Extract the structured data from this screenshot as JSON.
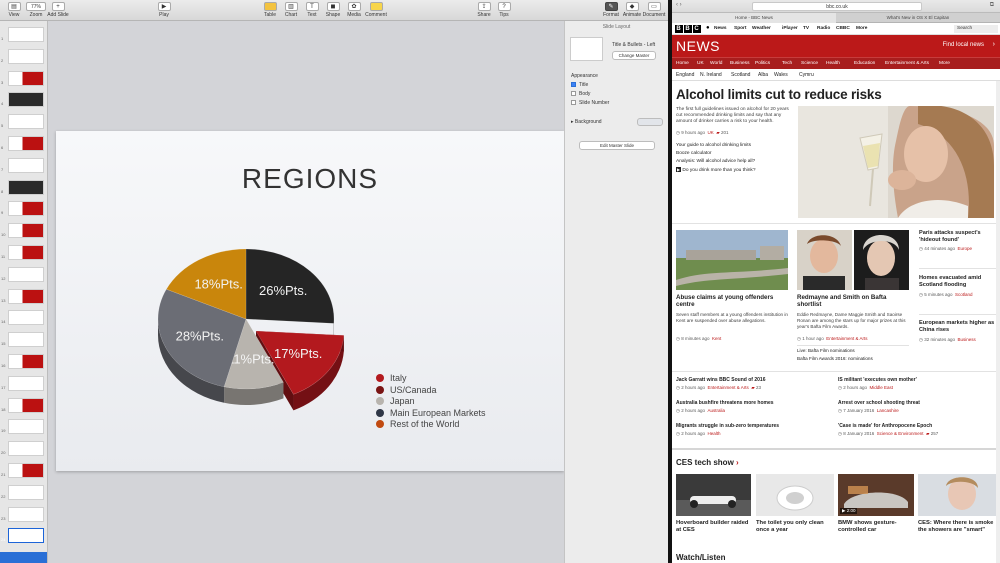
{
  "keynote": {
    "toolbar": {
      "view": "View",
      "zoom_value": "77%",
      "zoom": "Zoom",
      "add_slide": "Add Slide",
      "play": "Play",
      "table": "Table",
      "chart": "Chart",
      "text": "Text",
      "shape": "Shape",
      "media": "Media",
      "comment": "Comment",
      "share": "Share",
      "tips": "Tips",
      "format": "Format",
      "animate": "Animate",
      "document": "Document"
    },
    "slide_numbers": [
      "1",
      "2",
      "3",
      "4",
      "5",
      "6",
      "7",
      "8",
      "9",
      "10",
      "11",
      "12",
      "13",
      "14",
      "15",
      "16",
      "17",
      "18",
      "19",
      "20",
      "21",
      "22",
      "23",
      "24"
    ],
    "slide": {
      "title": "REGIONS"
    },
    "inspector": {
      "header": "Slide Layout",
      "layout_name": "Title & Bullets - Left",
      "change_master": "Change Master",
      "appearance": "Appearance",
      "title_opt": "Title",
      "body_opt": "Body",
      "slide_number_opt": "Slide Number",
      "background": "Background",
      "edit_master": "Edit Master Slide"
    }
  },
  "chart_data": {
    "type": "pie",
    "title": "",
    "slices": [
      {
        "name": "Italy",
        "label": "17%Pts.",
        "value": 17,
        "color": "#b3191e"
      },
      {
        "name": "US/Canada",
        "label": "26%Pts.",
        "value": 26,
        "color": "#252525"
      },
      {
        "name": "Japan",
        "label": "11%Pts.",
        "value": 11,
        "color": "#b8b4ae"
      },
      {
        "name": "Main European Markets",
        "label": "28%Pts.",
        "value": 28,
        "color": "#6b6d75"
      },
      {
        "name": "Rest of the World",
        "label": "18%Pts.",
        "value": 18,
        "color": "#c9860c"
      }
    ],
    "legend": [
      "Italy",
      "US/Canada",
      "Japan",
      "Main European Markets",
      "Rest of the World"
    ],
    "legend_colors": [
      "#b3191e",
      "#7a1414",
      "#b8b4ae",
      "#2e3646",
      "#c14a10"
    ],
    "legend_position": "right"
  },
  "safari": {
    "url": "bbc.co.uk",
    "tabs": [
      "Home - BBC News",
      "What's New in OS X El Capitan"
    ],
    "search": "Search",
    "more": "More"
  },
  "bbc": {
    "top_nav": [
      "News",
      "Sport",
      "Weather",
      "iPlayer",
      "TV",
      "Radio",
      "CBBC",
      "More"
    ],
    "section": "NEWS",
    "find_local": "Find local news",
    "sub_nav": [
      "Home",
      "UK",
      "World",
      "Business",
      "Politics",
      "Tech",
      "Science",
      "Health",
      "Education",
      "Entertainment & Arts",
      "More"
    ],
    "regions": [
      "England",
      "N. Ireland",
      "Scotland",
      "Alba",
      "Wales",
      "Cymru"
    ],
    "lead": {
      "headline": "Alcohol limits cut to reduce risks",
      "summary": "The first full guidelines issued on alcohol for 20 years cut recommended drinking limits and say that any amount of drinker carries a risk to your health.",
      "time": "9 hours ago",
      "section": "UK",
      "comments": "201",
      "links": [
        "Your guide to alcohol drinking limits",
        "Booze calculator",
        "Analysis: Will alcohol advice help all?",
        "Do you drink more than you think?"
      ]
    },
    "stories": [
      {
        "headline": "Abuse claims at young offenders centre",
        "summary": "Seven staff members at a young offenders institution in Kent are suspended over abuse allegations.",
        "time": "8 minutes ago",
        "section": "Kent"
      },
      {
        "headline": "Redmayne and Smith on Bafta shortlist",
        "summary": "Eddie Redmayne, Dame Maggie Smith and Saoirse Ronan are among the stars up for major prizes at this year's Bafta Film Awards.",
        "time": "1 hour ago",
        "section": "Entertainment & Arts",
        "live": "Live: Bafta Film nominations",
        "extra": "Bafta Film Awards 2016: nominations"
      }
    ],
    "side_stories": [
      {
        "headline": "Paris attacks suspect's 'hideout found'",
        "time": "44 minutes ago",
        "section": "Europe"
      },
      {
        "headline": "Homes evacuated amid Scotland flooding",
        "time": "5 minutes ago",
        "section": "Scotland"
      },
      {
        "headline": "European markets higher as China rises",
        "time": "32 minutes ago",
        "section": "Business"
      }
    ],
    "list": [
      {
        "headline": "Jack Garratt wins BBC Sound of 2016",
        "time": "2 hours ago",
        "section": "Entertainment & Arts",
        "comments": "23"
      },
      {
        "headline": "IS militant 'executes own mother'",
        "time": "2 hours ago",
        "section": "Middle East"
      },
      {
        "headline": "Australia bushfire threatens more homes",
        "time": "2 hours ago",
        "section": "Australia"
      },
      {
        "headline": "Arrest over school shooting threat",
        "time": "7 January 2016",
        "section": "Lancashire"
      },
      {
        "headline": "Migrants struggle in sub-zero temperatures",
        "time": "2 hours ago",
        "section": "Health"
      },
      {
        "headline": "'Case is made' for Anthropocene Epoch",
        "time": "8 January 2016",
        "section": "Science & Environment",
        "comments": "257"
      }
    ],
    "ces": {
      "title": "CES tech show",
      "items": [
        "Hoverboard builder raided at CES",
        "The toilet you only clean once a year",
        "BMW shows gesture-controlled car",
        "CES: Where there is smoke the showers are \"smart\""
      ],
      "badge": "2:00"
    },
    "next_section": "Watch/Listen"
  }
}
